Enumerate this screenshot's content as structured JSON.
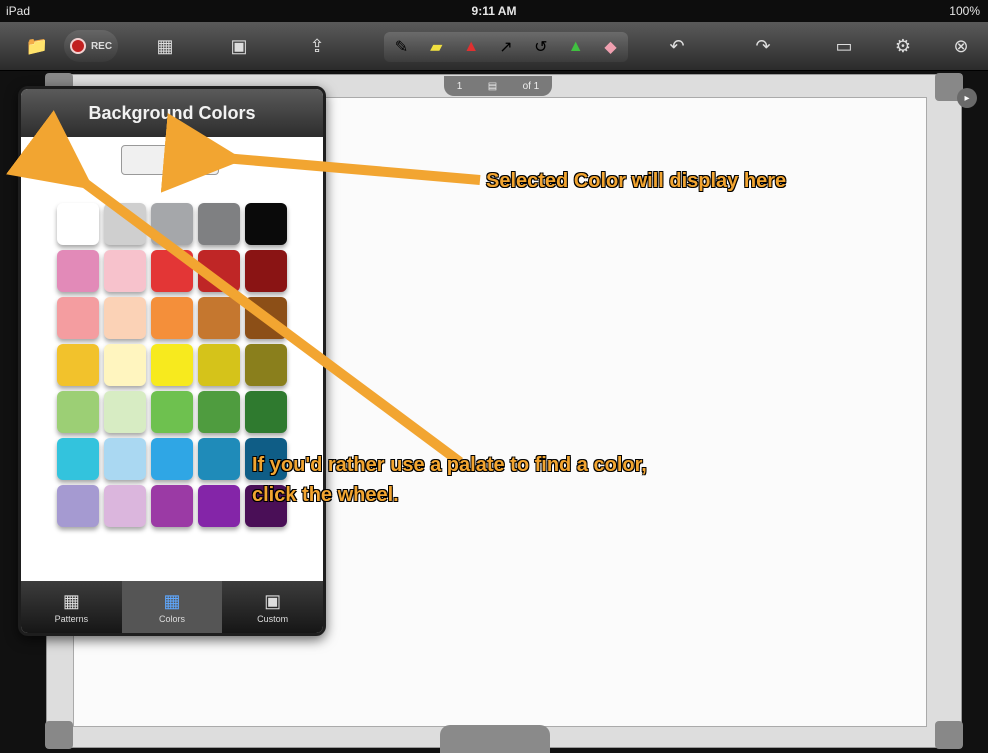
{
  "status": {
    "device": "iPad",
    "time": "9:11 AM",
    "battery": "100%"
  },
  "toolbar": {
    "rec_label": "REC"
  },
  "page": {
    "prev": "1",
    "next": "of 1"
  },
  "panel": {
    "title": "Background Colors",
    "tabs": [
      "Patterns",
      "Colors",
      "Custom"
    ],
    "active_tab": "Colors",
    "colors": [
      "#ffffff",
      "#cfcfcf",
      "#a5a7aa",
      "#7f8082",
      "#0a0a0a",
      "#e28ab8",
      "#f7c2cc",
      "#e33636",
      "#bf2626",
      "#8a1414",
      "#f49da0",
      "#fbd2b6",
      "#f48f3a",
      "#c5772f",
      "#8c4f17",
      "#f2c22c",
      "#fff5bf",
      "#f7ea1e",
      "#d5c31a",
      "#8a7f1c",
      "#9ccf75",
      "#d7ecc3",
      "#6ec14f",
      "#4f9c3f",
      "#2f7a2f",
      "#33c3dd",
      "#aad8f2",
      "#2fa6e5",
      "#1f8bb9",
      "#0f5d86",
      "#a59ad1",
      "#dbb6dd",
      "#9b3aa5",
      "#8425a8",
      "#4a0f57"
    ]
  },
  "annotations": {
    "selected_label": "Selected Color will display here",
    "wheel_label_line1": "If you'd rather use a palate to find a color,",
    "wheel_label_line2": "click the wheel."
  }
}
